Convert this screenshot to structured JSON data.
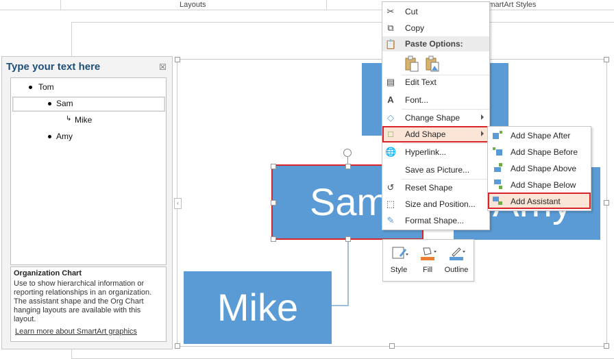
{
  "ribbon": {
    "layouts_label": "Layouts",
    "smartart_styles_label": "SmartArt Styles"
  },
  "text_pane": {
    "title": "Type your text here",
    "close_glyph": "☒",
    "items": [
      {
        "label": "Tom",
        "level": 1
      },
      {
        "label": "Sam",
        "level": 2
      },
      {
        "label": "Mike",
        "level": 3
      },
      {
        "label": "Amy",
        "level": 2
      }
    ],
    "description_title": "Organization Chart",
    "description_text": "Use to show hierarchical information or reporting relationships in an organization. The assistant shape and the Org Chart hanging layouts are available with this layout.",
    "learn_more_link": "Learn more about SmartArt graphics"
  },
  "chart_shapes": {
    "sam": "Sam",
    "amy": "Amy",
    "mike": "Mike"
  },
  "context_menu": {
    "cut": "Cut",
    "copy": "Copy",
    "paste_options": "Paste Options:",
    "edit_text": "Edit Text",
    "font": "Font...",
    "change_shape": "Change Shape",
    "add_shape": "Add Shape",
    "hyperlink": "Hyperlink...",
    "save_as_picture": "Save as Picture...",
    "reset_shape": "Reset Shape",
    "size_and_position": "Size and Position...",
    "format_shape": "Format Shape..."
  },
  "add_shape_submenu": {
    "after": "Add Shape After",
    "before": "Add Shape Before",
    "above": "Add Shape Above",
    "below": "Add Shape Below",
    "assistant": "Add Assistant"
  },
  "mini_toolbar": {
    "style": "Style",
    "fill": "Fill",
    "outline": "Outline"
  },
  "colors": {
    "shape_fill": "#5b9bd5",
    "highlight_border": "#d9252a",
    "highlight_fill": "#fbe5d6",
    "fill_swatch": "#ed7d31",
    "outline_swatch": "#5b9bd5"
  }
}
